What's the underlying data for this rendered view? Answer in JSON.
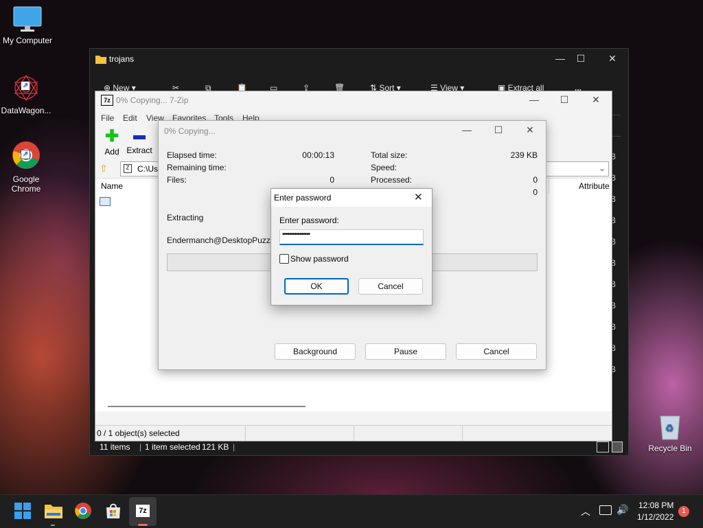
{
  "desktop": {
    "icons": [
      {
        "label": "My Computer"
      },
      {
        "label": "DataWagon..."
      },
      {
        "label": "Google Chrome"
      },
      {
        "label": "Recycle Bin"
      }
    ]
  },
  "explorer": {
    "title": "trojans",
    "toolbar": {
      "new": "New",
      "sort": "Sort",
      "view": "View",
      "extract_all": "Extract all",
      "more": "..."
    },
    "side_letters": [
      "B",
      "B",
      "B",
      "B",
      "B",
      "B",
      "B",
      "B",
      "B",
      "B",
      "B"
    ],
    "status": {
      "items": "11 items",
      "selected": "1 item selected",
      "size": "121 KB"
    }
  },
  "zip": {
    "title": "0% Copying... 7-Zip",
    "icon_text": "7z",
    "menu": [
      "File",
      "Edit",
      "View",
      "Favorites",
      "Tools",
      "Help"
    ],
    "toolbar": {
      "add": "Add",
      "extract": "Extract"
    },
    "address": "C:\\Use",
    "columns": {
      "name": "Name",
      "attributes": "Attribute"
    },
    "status": "0 / 1 object(s) selected"
  },
  "copy_dialog": {
    "title": "0% Copying...",
    "elapsed_label": "Elapsed time:",
    "elapsed_value": "00:00:13",
    "remaining_label": "Remaining time:",
    "files_label": "Files:",
    "files_value": "0",
    "total_size_label": "Total size:",
    "total_size_value": "239 KB",
    "speed_label": "Speed:",
    "processed_label": "Processed:",
    "processed_value": "0",
    "fourth_value": "0",
    "extracting_label": "Extracting",
    "file_name": "Endermanch@DesktopPuzzle.ex",
    "progress": 0,
    "buttons": {
      "background": "Background",
      "pause": "Pause",
      "cancel": "Cancel"
    }
  },
  "password_dialog": {
    "title": "Enter password",
    "label": "Enter password:",
    "password_value": "••••••••••••••••",
    "show_password": "Show password",
    "ok": "OK",
    "cancel": "Cancel"
  },
  "taskbar": {
    "time": "12:08 PM",
    "date": "1/12/2022",
    "notification_count": "1",
    "zip_icon_text": "7z"
  },
  "colors": {
    "accent": "#0067c0",
    "taskbar": "#1f1f1f"
  }
}
